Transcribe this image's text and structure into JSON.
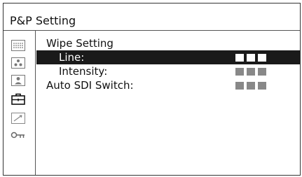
{
  "window": {
    "title": "P&P Setting"
  },
  "sidebar": {
    "icons": [
      {
        "name": "grid-dots-icon"
      },
      {
        "name": "camera-pair-icon"
      },
      {
        "name": "person-icon"
      },
      {
        "name": "toolbox-icon"
      },
      {
        "name": "pen-icon"
      },
      {
        "name": "key-icon"
      }
    ],
    "selected_index": 3
  },
  "menu": {
    "items": [
      {
        "label": "Wipe Setting",
        "value_squares": null,
        "selected": false
      },
      {
        "label": "Line:",
        "value_squares": 3,
        "selected": true
      },
      {
        "label": "Intensity:",
        "value_squares": 3,
        "selected": false
      },
      {
        "label": "Auto SDI Switch:",
        "value_squares": 3,
        "selected": false
      }
    ]
  },
  "colors": {
    "highlight": "#1a1a1a",
    "value_square_dim": "#888888",
    "value_square_active": "#ffffff"
  }
}
